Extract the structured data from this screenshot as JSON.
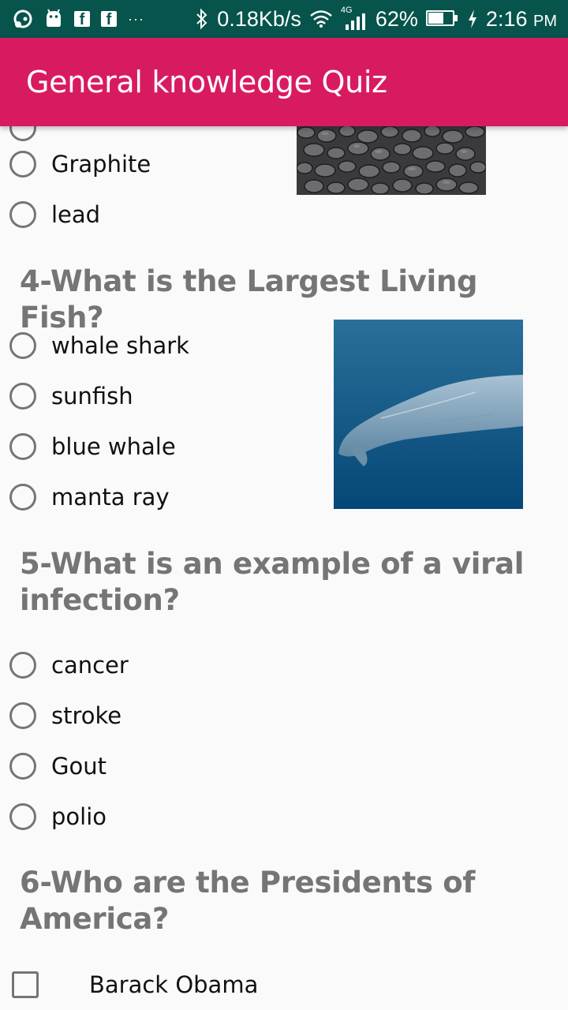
{
  "status_bar": {
    "network_speed": "0.18Kb/s",
    "network_type": "4G",
    "battery_percent": "62%",
    "battery_level": 0.62,
    "time": "2:16",
    "ampm": "PM"
  },
  "app_bar": {
    "title": "General knowledge Quiz"
  },
  "question3": {
    "options": [
      "Graphite",
      "lead"
    ],
    "image": "coal-image"
  },
  "question4": {
    "text": "4-What is the Largest Living Fish?",
    "options": [
      "whale shark",
      "sunfish",
      "blue whale",
      "manta ray"
    ],
    "image": "whale-image"
  },
  "question5": {
    "line1": "5-What is an example of a viral",
    "line2": "infection?",
    "options": [
      "cancer",
      "stroke",
      "Gout",
      "polio"
    ]
  },
  "question6": {
    "line1": "6-Who are the Presidents of",
    "line2": "America?",
    "options": [
      "Barack Obama"
    ]
  },
  "colors": {
    "status_bar": "#06544c",
    "app_bar": "#d81b60",
    "question_text": "#757575",
    "background": "#fafafa"
  }
}
